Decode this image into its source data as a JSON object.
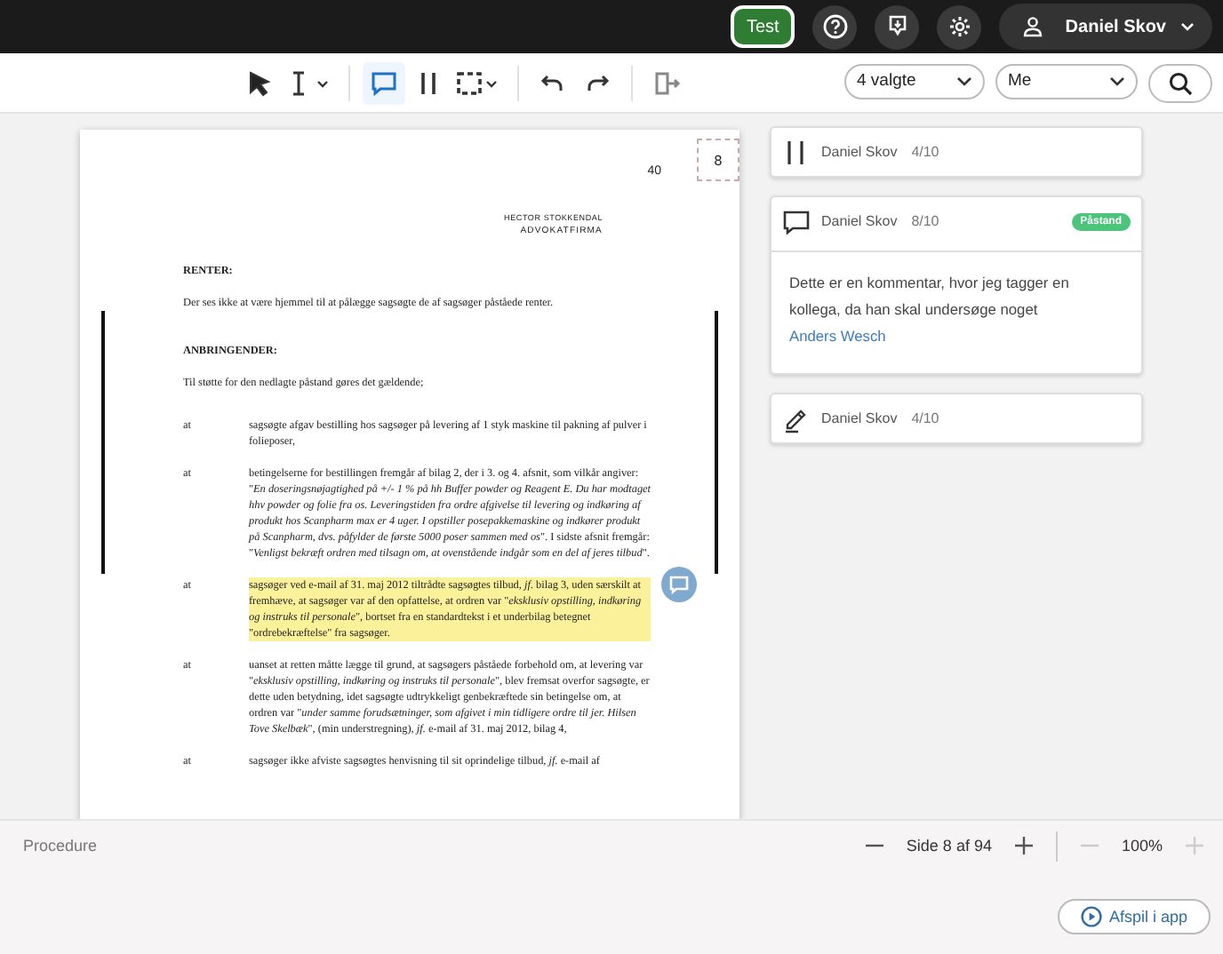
{
  "topbar": {
    "env_button": "Test",
    "user": "Daniel Skov"
  },
  "toolbar": {
    "tools": [
      {
        "kind": "pointer",
        "selected": false
      },
      {
        "kind": "text",
        "selected": false
      },
      {
        "kind": "comment",
        "selected": true
      },
      {
        "kind": "bars",
        "selected": false
      },
      {
        "kind": "region",
        "selected": false
      },
      {
        "kind": "undo",
        "selected": false
      },
      {
        "kind": "redo",
        "selected": false
      },
      {
        "kind": "export",
        "selected": false
      }
    ],
    "filter_1": "4 valgte",
    "filter_2": "Me"
  },
  "document": {
    "page_number": "40",
    "page_marker": "8",
    "letterhead": "HECTOR STOKKENDAL",
    "letterhead_sub": "ADVOKATFIRMA",
    "blocks": [
      {
        "kind": "heading",
        "text": "RENTER:"
      },
      {
        "kind": "para",
        "text": "Der ses ikke at være hjemmel til at pålægge sagsøgte de af sagsøger påståede renter."
      },
      {
        "kind": "heading",
        "text": "ANBRINGENDER:"
      },
      {
        "kind": "para",
        "text": "Til støtte for den nedlagte påstand gøres det gældende;"
      },
      {
        "kind": "item",
        "marker": "at",
        "text": "sagsøgte afgav bestilling hos sagsøger på levering af 1 styk maskine til pakning af pulver i folieposer,",
        "highlighted": false
      },
      {
        "kind": "item",
        "marker": "at",
        "text": "betingelserne for bestillingen fremgår af bilag 2, der i 3. og 4. afsnit, som vilkår angiver: \"*En doseringsnøjagtighed på +/- 1 % på hh Buffer powder og Reagent E. Du har modtaget hhv powder og folie fra os. Leveringstiden fra ordre afgivelse til levering og indkøring af produkt hos Scanpharm max er 4 uger. I opstiller posepakkemaskine og indkører produkt på Scanpharm, dvs. påfylder de første 5000 poser sammen med os*\". I sidste afsnit fremgår: \"*Venligst bekræft ordren med tilsagn om, at ovenstående indgår som en del af jeres tilbud*\".",
        "highlighted": false
      },
      {
        "kind": "item",
        "marker": "at",
        "text": "sagsøger ved e-mail af 31. maj 2012 tiltrådte sagsøgtes tilbud, *jf.* bilag 3, uden særskilt at fremhæve, at sagsøger var af den opfattelse, at ordren var \"*eksklusiv opstilling, indkøring og instruks til personale*\", bortset fra en standardtekst i et underbilag betegnet \"ordrebekræftelse\" fra sagsøger.",
        "highlighted": true
      },
      {
        "kind": "item",
        "marker": "at",
        "text": "uanset at retten måtte lægge til grund, at sagsøgers påståede forbehold om, at levering var \"*eksklusiv opstilling, indkøring og instruks til personale*\", blev fremsat overfor sagsøgte, er dette uden betydning, idet sagsøgte udtrykkeligt genbekræftede sin betingelse om, at ordren var \"*under samme forudsætninger, som afgivet i min tidligere ordre til jer. Hilsen Tove Skelbæk*\", (min understregning), *jf.* e-mail af 31. maj 2012, bilag 4,",
        "highlighted": false
      },
      {
        "kind": "item",
        "marker": "at",
        "text": "sagsøger ikke afviste sagsøgtes henvisning til sit oprindelige tilbud, *jf.* e-mail af",
        "highlighted": false
      }
    ]
  },
  "comments": [
    {
      "kind": "bars",
      "author": "Daniel Skov",
      "date": "4/10"
    },
    {
      "kind": "comment",
      "author": "Daniel Skov",
      "date": "8/10",
      "tag": "Påstand",
      "text": "Dette er en kommentar, hvor jeg tagger en kollega, da han skal undersøge noget",
      "mention": "Anders Wesch"
    },
    {
      "kind": "pen",
      "author": "Daniel Skov",
      "date": "4/10"
    }
  ],
  "footer": {
    "label": "Procedure",
    "page_text": "Side 8 af 94",
    "page_minus_disabled": false,
    "page_plus_disabled": false,
    "zoom_text": "100%",
    "zoom_minus_disabled": true,
    "zoom_plus_disabled": true,
    "play_button": "Afspil i app"
  }
}
